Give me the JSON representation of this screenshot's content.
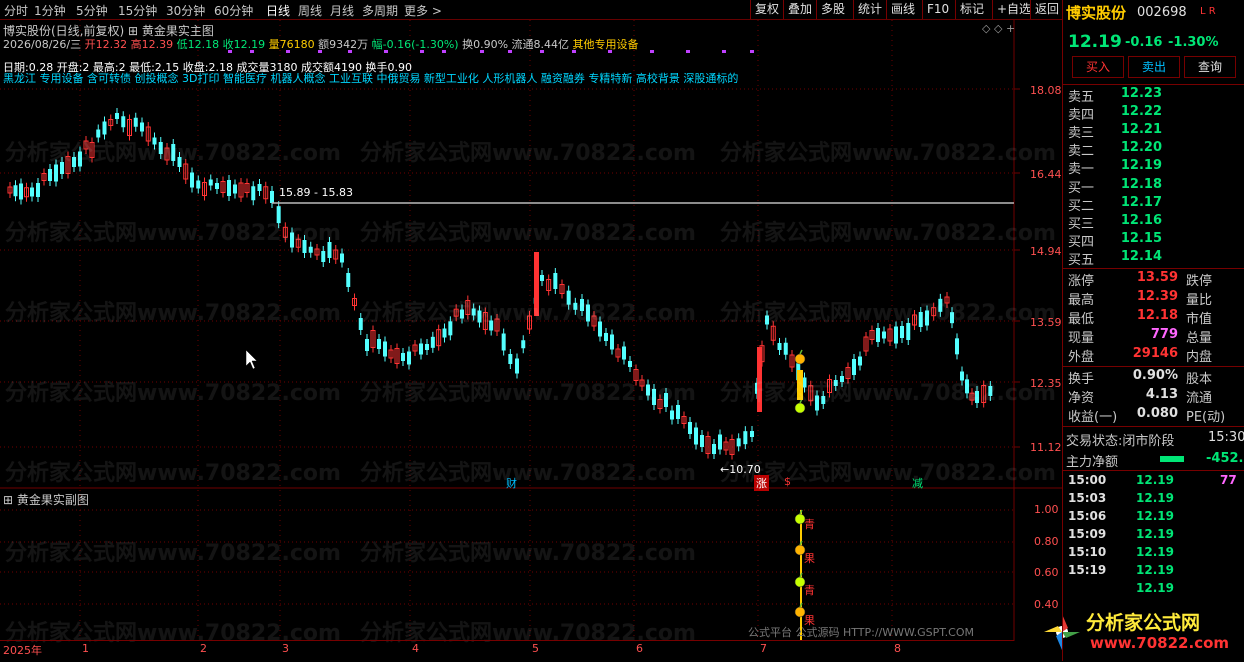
{
  "toolbar": {
    "periods": [
      "分时",
      "1分钟",
      "5分钟",
      "15分钟",
      "30分钟",
      "60分钟",
      "日线",
      "周线",
      "月线",
      "多周期",
      "更多"
    ],
    "active_period": "日线",
    "right_buttons": [
      "复权",
      "叠加",
      "多股",
      "统计",
      "画线",
      "F10",
      "标记",
      "+自选",
      "返回"
    ]
  },
  "main_chart": {
    "title": "博实股份(日线,前复权)",
    "indicator_name": "黄金果实主图",
    "date": "2026/08/26/三",
    "open_label": "开",
    "open": "12.32",
    "high_label": "高",
    "high": "12.39",
    "low_label": "低",
    "low": "12.18",
    "close_label": "收",
    "close": "12.19",
    "volume_label": "量",
    "volume": "76180",
    "amount_label": "额",
    "amount": "9342万",
    "change_label": "幅",
    "change": "-0.16(-1.30%)",
    "turnover_label": "换",
    "turnover": "0.90%",
    "float_label": "流通",
    "float": "8.44亿",
    "industry": "其他专用设备",
    "concepts": "黑龙江 专用设备 含可转债 创投概念 3D打印 智能医疗 机器人概念 工业互联 中俄贸易 新型工业化 人形机器人 融资融券 专精特新 高校背景 深股通标的",
    "overlay_line": "日期:0.28  开盘:2  最高:2  最低:2.15  收盘:2.18  成交量3180  成交额4190  换手0.90",
    "price_ticks": [
      "18.08",
      "16.44",
      "14.94",
      "13.59",
      "12.35",
      "11.12"
    ],
    "level_label": "15.89 - 15.83",
    "low_label_text": "10.70",
    "event_markers": [
      "财",
      "涨",
      "$",
      "减"
    ]
  },
  "sub_chart": {
    "title": "黄金果实副图",
    "ticks": [
      "1.00",
      "0.80",
      "0.60",
      "0.40"
    ],
    "markers": [
      "青",
      "果",
      "青",
      "果"
    ]
  },
  "time_axis": [
    "2025年",
    "1",
    "2",
    "3",
    "4",
    "5",
    "6",
    "7",
    "8"
  ],
  "footer_text": "公式平台  公式源码 HTTP://WWW.GSPT.COM",
  "logo": {
    "title": "分析家公式网",
    "url": "www.70822.com"
  },
  "watermark": "分析家公式网www.70822.com",
  "right_panel": {
    "stock_name": "博实股份",
    "stock_code": "002698",
    "flags": "L R",
    "price": "12.19",
    "change": "-0.16",
    "change_pct": "-1.30%",
    "buy_button": "买入",
    "sell_button": "卖出",
    "query_button": "查询",
    "asks": [
      {
        "label": "卖五",
        "price": "12.23"
      },
      {
        "label": "卖四",
        "price": "12.22"
      },
      {
        "label": "卖三",
        "price": "12.21"
      },
      {
        "label": "卖二",
        "price": "12.20"
      },
      {
        "label": "卖一",
        "price": "12.19"
      }
    ],
    "bids": [
      {
        "label": "买一",
        "price": "12.18"
      },
      {
        "label": "买二",
        "price": "12.17"
      },
      {
        "label": "买三",
        "price": "12.16"
      },
      {
        "label": "买四",
        "price": "12.15"
      },
      {
        "label": "买五",
        "price": "12.14"
      }
    ],
    "stats": [
      {
        "l1": "涨停",
        "v1": "13.59",
        "l2": "跌停"
      },
      {
        "l1": "最高",
        "v1": "12.39",
        "l2": "量比"
      },
      {
        "l1": "最低",
        "v1": "12.18",
        "l2": "市值"
      },
      {
        "l1": "现量",
        "v1": "779",
        "l2": "总量"
      },
      {
        "l1": "外盘",
        "v1": "29146",
        "l2": "内盘"
      }
    ],
    "stats2": [
      {
        "l1": "换手",
        "v1": "0.90%",
        "l2": "股本"
      },
      {
        "l1": "净资",
        "v1": "4.13",
        "l2": "流通"
      },
      {
        "l1": "收益(一)",
        "v1": "0.080",
        "l2": "PE(动)"
      }
    ],
    "trade_status_label": "交易状态:",
    "trade_status": "闭市阶段",
    "trade_time": "15:30",
    "main_net_label": "主力净额",
    "main_net_value": "-452.",
    "ticks": [
      {
        "time": "15:00",
        "price": "12.19",
        "vol": "77"
      },
      {
        "time": "15:03",
        "price": "12.19",
        "vol": ""
      },
      {
        "time": "15:06",
        "price": "12.19",
        "vol": ""
      },
      {
        "time": "15:09",
        "price": "12.19",
        "vol": ""
      },
      {
        "time": "15:10",
        "price": "12.19",
        "vol": ""
      },
      {
        "time": "15:19",
        "price": "12.19",
        "vol": ""
      },
      {
        "time": "",
        "price": "12.19",
        "vol": ""
      }
    ]
  },
  "colors": {
    "up": "#ff3333",
    "down": "#54ffff",
    "accent": "#ffcc00",
    "grid": "#700000"
  }
}
